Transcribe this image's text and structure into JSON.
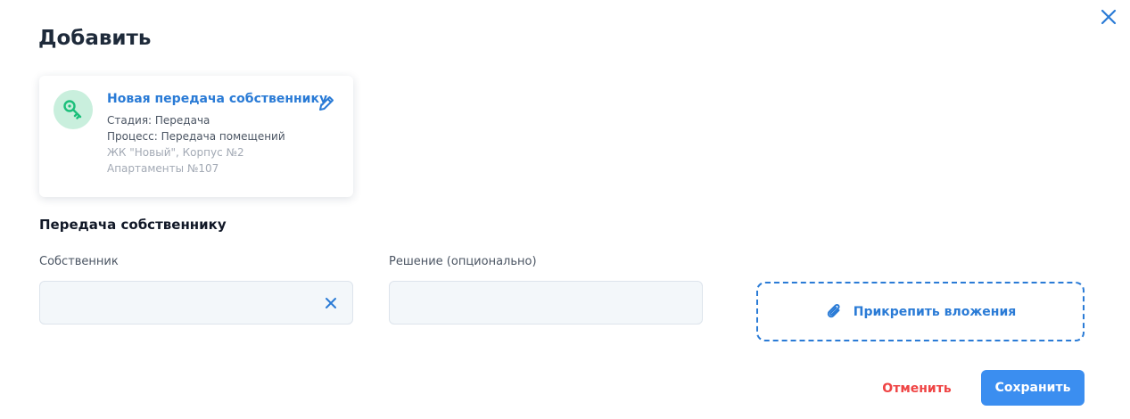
{
  "dialog": {
    "title": "Добавить",
    "close_icon": "close-icon"
  },
  "card": {
    "icon": "key-icon",
    "title": "Новая передача собственнику",
    "stage": "Стадия: Передача",
    "process": "Процесс: Передача помещений",
    "complex": "ЖК \"Новый\", Корпус №2",
    "apartment": "Апартаменты №107",
    "edit_icon": "pencil-icon"
  },
  "section": {
    "title": "Передача собственнику"
  },
  "fields": {
    "owner": {
      "label": "Собственник",
      "value": "",
      "clear_icon": "close-icon"
    },
    "decision": {
      "label": "Решение (опционально)",
      "value": ""
    }
  },
  "attachments": {
    "label": "Прикрепить вложения",
    "icon": "paperclip-icon"
  },
  "actions": {
    "cancel_label": "Отменить",
    "save_label": "Сохранить"
  },
  "colors": {
    "accent": "#2a7bd6",
    "primary_button": "#3b8ef0",
    "danger": "#ef4444",
    "key_icon_bg": "#c9efdd",
    "key_icon_fg": "#1bbf7a"
  }
}
